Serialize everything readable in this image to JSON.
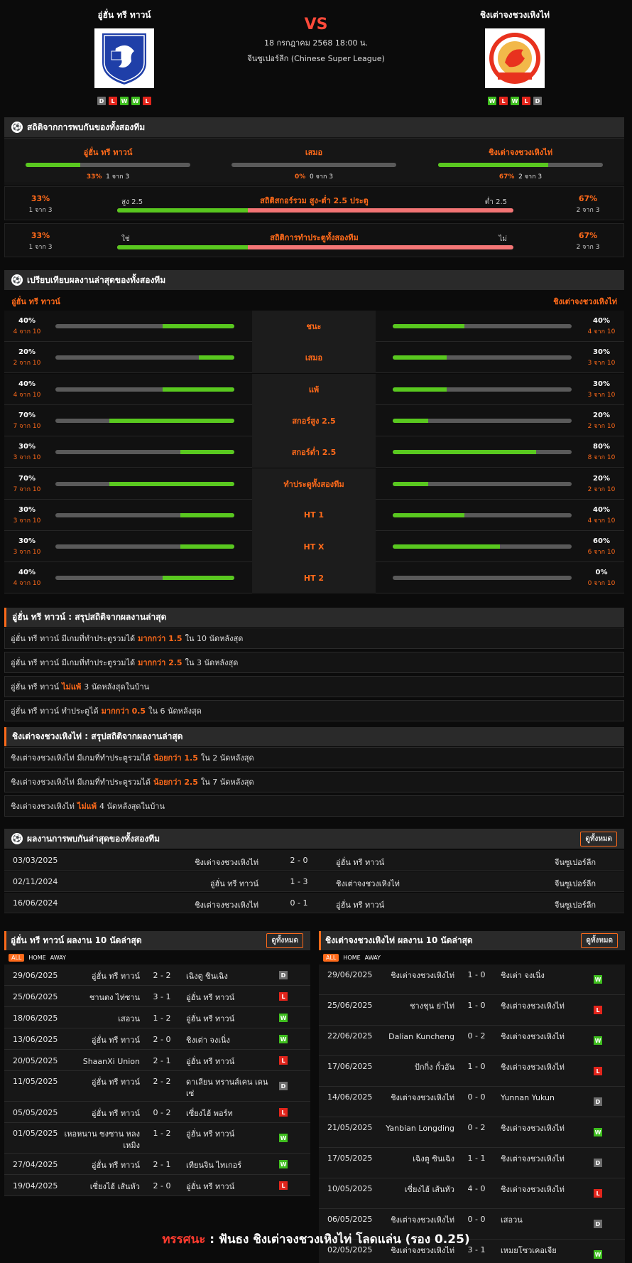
{
  "match": {
    "home": "อู่ฮั่น ทรี ทาวน์",
    "away": "ชิงเต่าจงชวงเหิงไท่",
    "vs": "VS",
    "datetime": "18 กรกฎาคม 2568 18:00 น.",
    "league": "จีนซูเปอร์ลีก (Chinese Super League)",
    "home_form": [
      "D",
      "L",
      "W",
      "W",
      "L"
    ],
    "away_form": [
      "W",
      "L",
      "W",
      "L",
      "D"
    ],
    "home_logo_text": "WUHAN THREE TOWNS 2013",
    "away_logo_text": "ZCHT SINCE 2007"
  },
  "h2h_stats": {
    "title": "สถิติจากการพบกันของทั้งสองทีม",
    "home_label": "อู่ฮั่น ทรี ทาวน์",
    "home_pct": "33%",
    "home_sub": "1 จาก 3",
    "home_val": 33,
    "draw_label": "เสมอ",
    "draw_pct": "0%",
    "draw_sub": "0 จาก 3",
    "draw_val": 0,
    "away_label": "ชิงเต่าจงชวงเหิงไท่",
    "away_pct": "67%",
    "away_sub": "2 จาก 3",
    "away_val": 67,
    "ou": {
      "title": "สถิติสกอร์รวม สูง-ต่ำ 2.5 ประตู",
      "left_label": "สูง 2.5",
      "right_label": "ต่ำ 2.5",
      "left_pct": "33%",
      "left_sub": "1 จาก 3",
      "right_pct": "67%",
      "right_sub": "2 จาก 3",
      "left_val": 33
    },
    "btts": {
      "title": "สถิติการทำประตูทั้งสองทีม",
      "left_label": "ใช่",
      "right_label": "ไม่",
      "left_pct": "33%",
      "left_sub": "1 จาก 3",
      "right_pct": "67%",
      "right_sub": "2 จาก 3",
      "left_val": 33
    }
  },
  "compare": {
    "title": "เปรียบเทียบผลงานล่าสุดของทั้งสองทีม",
    "home_label": "อู่ฮั่น ทรี ทาวน์",
    "away_label": "ชิงเต่าจงชวงเหิงไท่",
    "rows": [
      {
        "label": "ชนะ",
        "hp": "40%",
        "hs": "4 จาก 10",
        "hv": 40,
        "ap": "40%",
        "as": "4 จาก 10",
        "av": 40
      },
      {
        "label": "เสมอ",
        "hp": "20%",
        "hs": "2 จาก 10",
        "hv": 20,
        "ap": "30%",
        "as": "3 จาก 10",
        "av": 30
      },
      {
        "label": "แพ้",
        "hp": "40%",
        "hs": "4 จาก 10",
        "hv": 40,
        "ap": "30%",
        "as": "3 จาก 10",
        "av": 30
      },
      {
        "label": "สกอร์สูง 2.5",
        "hp": "70%",
        "hs": "7 จาก 10",
        "hv": 70,
        "ap": "20%",
        "as": "2 จาก 10",
        "av": 20
      },
      {
        "label": "สกอร์ต่ำ 2.5",
        "hp": "30%",
        "hs": "3 จาก 10",
        "hv": 30,
        "ap": "80%",
        "as": "8 จาก 10",
        "av": 80
      },
      {
        "label": "ทำประตูทั้งสองทีม",
        "hp": "70%",
        "hs": "7 จาก 10",
        "hv": 70,
        "ap": "20%",
        "as": "2 จาก 10",
        "av": 20
      },
      {
        "label": "HT 1",
        "hp": "30%",
        "hs": "3 จาก 10",
        "hv": 30,
        "ap": "40%",
        "as": "4 จาก 10",
        "av": 40
      },
      {
        "label": "HT X",
        "hp": "30%",
        "hs": "3 จาก 10",
        "hv": 30,
        "ap": "60%",
        "as": "6 จาก 10",
        "av": 60
      },
      {
        "label": "HT 2",
        "hp": "40%",
        "hs": "4 จาก 10",
        "hv": 40,
        "ap": "0%",
        "as": "0 จาก 10",
        "av": 0
      }
    ]
  },
  "home_summary": {
    "title": "อู่ฮั่น ทรี ทาวน์ : สรุปสถิติจากผลงานล่าสุด",
    "lines": [
      {
        "a": "อู่ฮั่น ทรี ทาวน์ มีเกมที่ทำประตูรวมได้",
        "b": "มากกว่า 1.5",
        "c": "ใน 10 นัดหลังสุด"
      },
      {
        "a": "อู่ฮั่น ทรี ทาวน์ มีเกมที่ทำประตูรวมได้",
        "b": "มากกว่า 2.5",
        "c": "ใน 3 นัดหลังสุด"
      },
      {
        "a": "อู่ฮั่น ทรี ทาวน์",
        "b": "ไม่แพ้",
        "c": "3 นัดหลังสุดในบ้าน"
      },
      {
        "a": "อู่ฮั่น ทรี ทาวน์ ทำประตูได้",
        "b": "มากกว่า 0.5",
        "c": "ใน 6 นัดหลังสุด"
      }
    ]
  },
  "away_summary": {
    "title": "ชิงเต่าจงชวงเหิงไท่ : สรุปสถิติจากผลงานล่าสุด",
    "lines": [
      {
        "a": "ชิงเต่าจงชวงเหิงไท่ มีเกมที่ทำประตูรวมได้",
        "b": "น้อยกว่า 1.5",
        "c": "ใน 2 นัดหลังสุด"
      },
      {
        "a": "ชิงเต่าจงชวงเหิงไท่ มีเกมที่ทำประตูรวมได้",
        "b": "น้อยกว่า 2.5",
        "c": "ใน 7 นัดหลังสุด"
      },
      {
        "a": "ชิงเต่าจงชวงเหิงไท่",
        "b": "ไม่แพ้",
        "c": "4 นัดหลังสุดในบ้าน"
      }
    ]
  },
  "h2h": {
    "title": "ผลงานการพบกันล่าสุดของทั้งสองทีม",
    "view_all": "ดูทั้งหมด",
    "rows": [
      {
        "date": "03/03/2025",
        "home": "ชิงเต่าจงชวงเหิงไท่",
        "score": "2 - 0",
        "away": "อู่ฮั่น ทรี ทาวน์",
        "league": "จีนซูเปอร์ลีก"
      },
      {
        "date": "02/11/2024",
        "home": "อู่ฮั่น ทรี ทาวน์",
        "score": "1 - 3",
        "away": "ชิงเต่าจงชวงเหิงไท่",
        "league": "จีนซูเปอร์ลีก"
      },
      {
        "date": "16/06/2024",
        "home": "ชิงเต่าจงชวงเหิงไท่",
        "score": "0 - 1",
        "away": "อู่ฮั่น ทรี ทาวน์",
        "league": "จีนซูเปอร์ลีก"
      }
    ]
  },
  "home_last10": {
    "title": "อู่ฮั่น ทรี ทาวน์ ผลงาน 10 นัดล่าสุด",
    "view_all": "ดูทั้งหมด",
    "filters": [
      "ALL",
      "HOME",
      "AWAY"
    ],
    "rows": [
      {
        "date": "29/06/2025",
        "home": "อู่ฮั่น ทรี ทาวน์",
        "score": "2 - 2",
        "away": "เฉิงตู ซินเฉิง",
        "res": "D"
      },
      {
        "date": "25/06/2025",
        "home": "ชานตง ไท่ซาน",
        "score": "3 - 1",
        "away": "อู่ฮั่น ทรี ทาวน์",
        "res": "L"
      },
      {
        "date": "18/06/2025",
        "home": "เสอวน",
        "score": "1 - 2",
        "away": "อู่ฮั่น ทรี ทาวน์",
        "res": "W"
      },
      {
        "date": "13/06/2025",
        "home": "อู่ฮั่น ทรี ทาวน์",
        "score": "2 - 0",
        "away": "ชิงเต่า จงเนิ่ง",
        "res": "W"
      },
      {
        "date": "20/05/2025",
        "home": "ShaanXi Union",
        "score": "2 - 1",
        "away": "อู่ฮั่น ทรี ทาวน์",
        "res": "L"
      },
      {
        "date": "11/05/2025",
        "home": "อู่ฮั่น ทรี ทาวน์",
        "score": "2 - 2",
        "away": "ดาเลียน ทรานส์เคน เดนเซ่",
        "res": "D"
      },
      {
        "date": "05/05/2025",
        "home": "อู่ฮั่น ทรี ทาวน์",
        "score": "0 - 2",
        "away": "เซี่ยงไฮ้ พอร์ท",
        "res": "L"
      },
      {
        "date": "01/05/2025",
        "home": "เหอหนาน ซงซาน หลงเหมิง",
        "score": "1 - 2",
        "away": "อู่ฮั่น ทรี ทาวน์",
        "res": "W"
      },
      {
        "date": "27/04/2025",
        "home": "อู่ฮั่น ทรี ทาวน์",
        "score": "2 - 1",
        "away": "เทียนจิน ไทเกอร์",
        "res": "W"
      },
      {
        "date": "19/04/2025",
        "home": "เซี่ยงไฮ้ เส้นหัว",
        "score": "2 - 0",
        "away": "อู่ฮั่น ทรี ทาวน์",
        "res": "L"
      }
    ]
  },
  "away_last10": {
    "title": "ชิงเต่าจงชวงเหิงไท่ ผลงาน 10 นัดล่าสุด",
    "view_all": "ดูทั้งหมด",
    "filters": [
      "ALL",
      "HOME",
      "AWAY"
    ],
    "rows": [
      {
        "date": "29/06/2025",
        "home": "ชิงเต่าจงชวงเหิงไท่",
        "score": "1 - 0",
        "away": "ชิงเต่า จงเนิ่ง",
        "res": "W"
      },
      {
        "date": "25/06/2025",
        "home": "ชางชุน ย่าไท่",
        "score": "1 - 0",
        "away": "ชิงเต่าจงชวงเหิงไท่",
        "res": "L"
      },
      {
        "date": "22/06/2025",
        "home": "Dalian Kuncheng",
        "score": "0 - 2",
        "away": "ชิงเต่าจงชวงเหิงไท่",
        "res": "W"
      },
      {
        "date": "17/06/2025",
        "home": "ปักกิ่ง กั๋วอัน",
        "score": "1 - 0",
        "away": "ชิงเต่าจงชวงเหิงไท่",
        "res": "L"
      },
      {
        "date": "14/06/2025",
        "home": "ชิงเต่าจงชวงเหิงไท่",
        "score": "0 - 0",
        "away": "Yunnan Yukun",
        "res": "D"
      },
      {
        "date": "21/05/2025",
        "home": "Yanbian Longding",
        "score": "0 - 2",
        "away": "ชิงเต่าจงชวงเหิงไท่",
        "res": "W"
      },
      {
        "date": "17/05/2025",
        "home": "เฉิงตู ซินเฉิง",
        "score": "1 - 1",
        "away": "ชิงเต่าจงชวงเหิงไท่",
        "res": "D"
      },
      {
        "date": "10/05/2025",
        "home": "เซี่ยงไฮ้ เส้นหัว",
        "score": "4 - 0",
        "away": "ชิงเต่าจงชวงเหิงไท่",
        "res": "L"
      },
      {
        "date": "06/05/2025",
        "home": "ชิงเต่าจงชวงเหิงไท่",
        "score": "0 - 0",
        "away": "เสอวน",
        "res": "D"
      },
      {
        "date": "02/05/2025",
        "home": "ชิงเต่าจงชวงเหิงไท่",
        "score": "3 - 1",
        "away": "เหมยโซวเคอเจีย",
        "res": "W"
      }
    ]
  },
  "verdict": {
    "label": "ทรรศนะ",
    "sep": ":",
    "text": "ฟันธง ชิงเต่าจงชวงเหิงไท่ โลดแล่น (รอง 0.25)"
  },
  "colors": {
    "accent": "#ff6a1a",
    "win": "#3fbf1f",
    "loss": "#e3251c",
    "draw": "#6e6e6e",
    "bar_green": "#59c81f",
    "bar_red": "#f47676"
  },
  "icons": {
    "section": "soccer-ball-icon"
  }
}
